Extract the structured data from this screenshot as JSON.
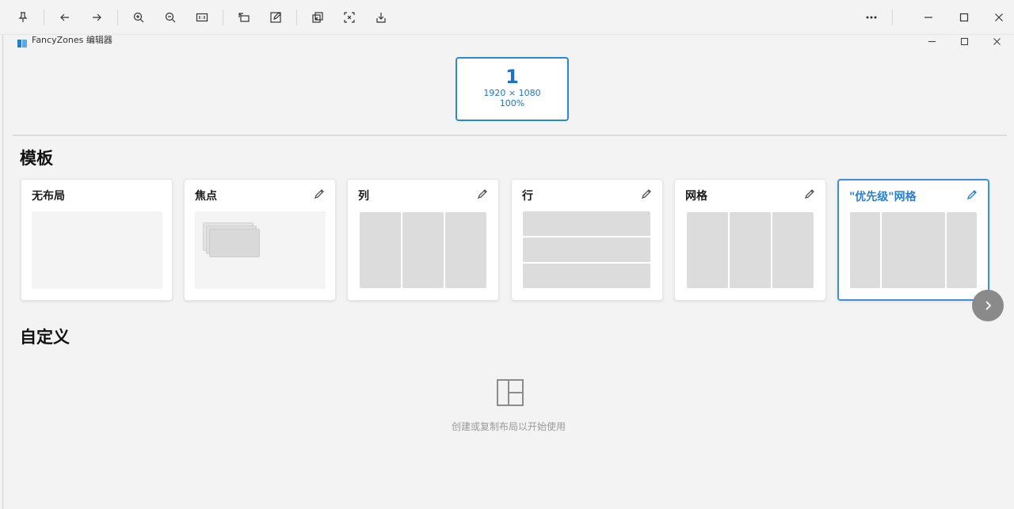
{
  "fz_window": {
    "title": "FancyZones 编辑器"
  },
  "monitor": {
    "number": "1",
    "resolution": "1920 × 1080",
    "scale": "100%"
  },
  "templates_heading": "模板",
  "templates": [
    {
      "name": "无布局",
      "editable": false,
      "selected": false
    },
    {
      "name": "焦点",
      "editable": true,
      "selected": false
    },
    {
      "name": "列",
      "editable": true,
      "selected": false
    },
    {
      "name": "行",
      "editable": true,
      "selected": false
    },
    {
      "name": "网格",
      "editable": true,
      "selected": false
    },
    {
      "name": "\"优先级\"网格",
      "editable": true,
      "selected": true
    }
  ],
  "custom_heading": "自定义",
  "custom_empty_text": "创建或复制布局以开始使用",
  "colors": {
    "accent": "#2b88d8",
    "zone": "#dcdcdc",
    "background": "#f3f3f3"
  }
}
